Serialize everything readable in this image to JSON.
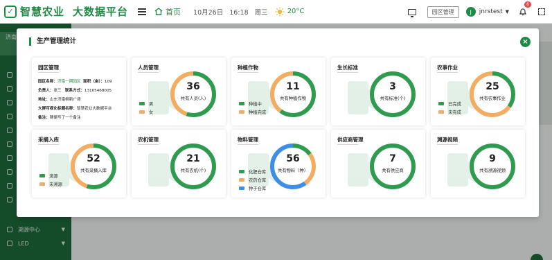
{
  "header": {
    "brand": "智慧农业",
    "platform": "大数据平台",
    "home_label": "首页",
    "date": "10月26日",
    "time": "16:18",
    "weekday": "周三",
    "temperature": "20°C",
    "park_button": "园区管理",
    "avatar_letter": "J",
    "username": "jnrstest",
    "bell_badge": "6"
  },
  "sidebar": {
    "tag_text": "济南",
    "items": [
      {
        "label": ""
      },
      {
        "label": ""
      },
      {
        "label": ""
      },
      {
        "label": ""
      },
      {
        "label": ""
      },
      {
        "label": ""
      },
      {
        "label": ""
      },
      {
        "label": ""
      },
      {
        "label": ""
      },
      {
        "label": ""
      },
      {
        "label": "溯源中心"
      },
      {
        "label": "LED"
      }
    ]
  },
  "modal": {
    "title": "生产管理统计",
    "colors": {
      "green": "#2e9b4f",
      "orange": "#f3ad62",
      "blue": "#3c8ee8"
    },
    "park": {
      "title": "园区管理",
      "park_name_label": "园区名称：",
      "park_name": "济南一期园区",
      "area_label": "面积（亩）：",
      "area": "109",
      "owner_label": "负责人：",
      "owner": "张三",
      "phone_label": "联系方式：",
      "phone": "13105468005",
      "address_label": "地址：",
      "address": "山东济南柳新广场",
      "screen_label": "大屏可视化标题名称：",
      "screen": "智慧农业大数据平台",
      "remark_label": "备注：",
      "remark": "随便写了一个备注"
    },
    "cards": [
      {
        "title": "人员管理",
        "value": "36",
        "caption": "共有人员(人)",
        "legend": [
          "男",
          "女"
        ]
      },
      {
        "title": "种植作物",
        "value": "11",
        "caption": "共有种植作物",
        "legend": [
          "种植中",
          "种植完成"
        ]
      },
      {
        "title": "生长标准",
        "value": "3",
        "caption": "共有标准(个)",
        "legend": []
      },
      {
        "title": "农事作业",
        "value": "25",
        "caption": "共有农事作业",
        "legend": [
          "已完成",
          "未完成"
        ]
      },
      {
        "title": "采摘入库",
        "value": "52",
        "caption": "共有采摘入库",
        "legend": [
          "滴源",
          "未溯源"
        ]
      },
      {
        "title": "农机管理",
        "value": "21",
        "caption": "共有农机(个)",
        "legend": []
      },
      {
        "title": "物料管理",
        "value": "56",
        "caption": "共有物料（种）",
        "legend": [
          "化肥仓库",
          "农药仓库",
          "种子仓库"
        ]
      },
      {
        "title": "供应商管理",
        "value": "7",
        "caption": "共有供应商",
        "legend": []
      },
      {
        "title": "溯源视频",
        "value": "9",
        "caption": "共有溯源视频",
        "legend": []
      }
    ],
    "rings": [
      {
        "segments": [
          0.55,
          0.45
        ]
      },
      {
        "segments": [
          0.6,
          0.4
        ]
      },
      {
        "segments": [
          1.0
        ]
      },
      {
        "segments": [
          0.35,
          0.65
        ]
      },
      {
        "segments": [
          0.55,
          0.45
        ]
      },
      {
        "segments": [
          1.0
        ]
      },
      {
        "segments": [
          0.15,
          0.25,
          0.6
        ]
      },
      {
        "segments": [
          1.0
        ]
      },
      {
        "segments": [
          1.0
        ]
      }
    ]
  }
}
